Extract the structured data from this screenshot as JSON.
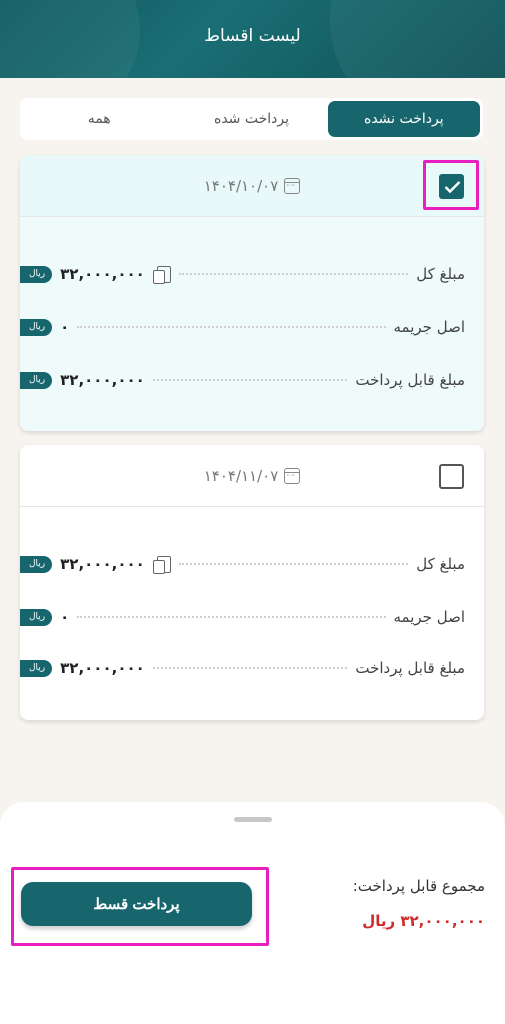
{
  "header": {
    "title": "لیست اقساط"
  },
  "tabs": [
    {
      "label": "پرداخت نشده",
      "active": true
    },
    {
      "label": "پرداخت شده",
      "active": false
    },
    {
      "label": "همه",
      "active": false
    }
  ],
  "installments": [
    {
      "date": "۱۴۰۴/۱۰/۰۷",
      "checked": true,
      "rows": [
        {
          "label": "مبلغ کل",
          "amount": "۳۲,۰۰۰,۰۰۰",
          "unit": "ریال"
        },
        {
          "label": "اصل جریمه",
          "amount": "۰",
          "unit": "ریال"
        },
        {
          "label": "مبلغ قابل پرداخت",
          "amount": "۳۲,۰۰۰,۰۰۰",
          "unit": "ریال"
        }
      ]
    },
    {
      "date": "۱۴۰۴/۱۱/۰۷",
      "checked": false,
      "rows": [
        {
          "label": "مبلغ کل",
          "amount": "۳۲,۰۰۰,۰۰۰",
          "unit": "ریال"
        },
        {
          "label": "اصل جریمه",
          "amount": "۰",
          "unit": "ریال"
        },
        {
          "label": "مبلغ قابل پرداخت",
          "amount": "۳۲,۰۰۰,۰۰۰",
          "unit": "ریال"
        }
      ]
    }
  ],
  "summary": {
    "total_label": "مجموع قابل پرداخت:",
    "total_amount": "۳۲,۰۰۰,۰۰۰ ریال",
    "pay_button": "پرداخت قسط"
  },
  "colors": {
    "primary": "#17666d",
    "highlight": "#e91ec1",
    "amount_red": "#d02a2a"
  }
}
